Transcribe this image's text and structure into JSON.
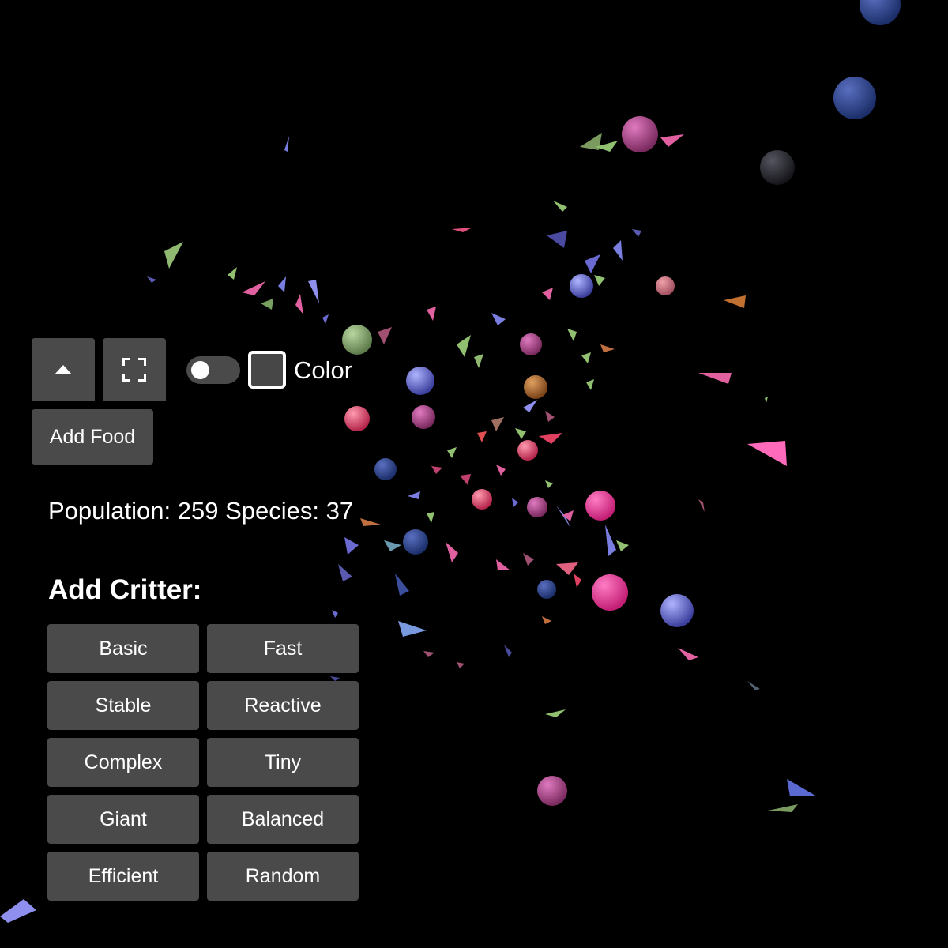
{
  "controls": {
    "collapse_icon": "caret-up-icon",
    "fullscreen_icon": "fullscreen-icon",
    "toggle_state": false,
    "color_label": "Color",
    "color_value": "#474747",
    "add_food_label": "Add Food"
  },
  "stats": {
    "text": "Population: 259 Species: 37",
    "population": 259,
    "species": 37
  },
  "add_critter": {
    "heading": "Add Critter:",
    "buttons": [
      "Basic",
      "Fast",
      "Stable",
      "Reactive",
      "Complex",
      "Tiny",
      "Giant",
      "Balanced",
      "Efficient",
      "Random"
    ]
  },
  "colors": {
    "background": "#000000",
    "button": "#4a4a4a",
    "text": "#ffffff"
  }
}
